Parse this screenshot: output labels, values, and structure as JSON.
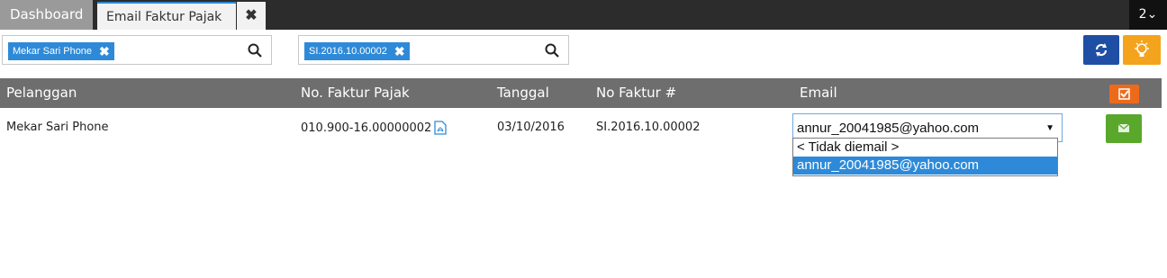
{
  "tabs": {
    "dashboard": "Dashboard",
    "active": "Email Faktur Pajak",
    "close": "✕",
    "count": "2⌄"
  },
  "filters": {
    "customer_chip": "Mekar Sari Phone",
    "invoice_chip": "SI.2016.10.00002",
    "chip_remove": "✖"
  },
  "table": {
    "headers": [
      "Pelanggan",
      "No. Faktur Pajak",
      "Tanggal",
      "No Faktur #",
      "Email"
    ],
    "rows": [
      {
        "pelanggan": "Mekar Sari Phone",
        "no_faktur_pajak": "010.900-16.00000002",
        "tanggal": "03/10/2016",
        "no_faktur": "SI.2016.10.00002",
        "email_selected": "annur_20041985@yahoo.com"
      }
    ]
  },
  "email_dropdown": {
    "options": [
      "< Tidak diemail >",
      "annur_20041985@yahoo.com"
    ]
  },
  "colors": {
    "accent": "#2e8ad8",
    "header_bg": "#6e6e6e",
    "topbar": "#2c2c2c",
    "refresh_btn": "#1f4fa5",
    "bulb_btn": "#f4a31c",
    "check_btn": "#ee6a1b",
    "mail_btn": "#5aa82b"
  }
}
